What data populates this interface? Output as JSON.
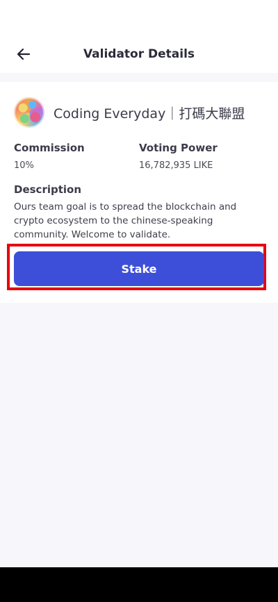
{
  "header": {
    "title": "Validator Details",
    "back_icon": "back-arrow-icon"
  },
  "validator": {
    "name": "Coding Everyday｜打碼大聯盟",
    "avatar_icon": "validator-avatar"
  },
  "stats": {
    "commission_label": "Commission",
    "commission_value": "10%",
    "voting_power_label": "Voting Power",
    "voting_power_value": "16,782,935 LIKE"
  },
  "description": {
    "label": "Description",
    "text": "Ours team goal is to spread the blockchain and crypto ecosystem to the chinese-speaking community. Welcome to validate."
  },
  "actions": {
    "stake_label": "Stake"
  },
  "colors": {
    "accent": "#3d4fd8",
    "highlight": "#e8000f",
    "background": "#f6f6fb"
  }
}
